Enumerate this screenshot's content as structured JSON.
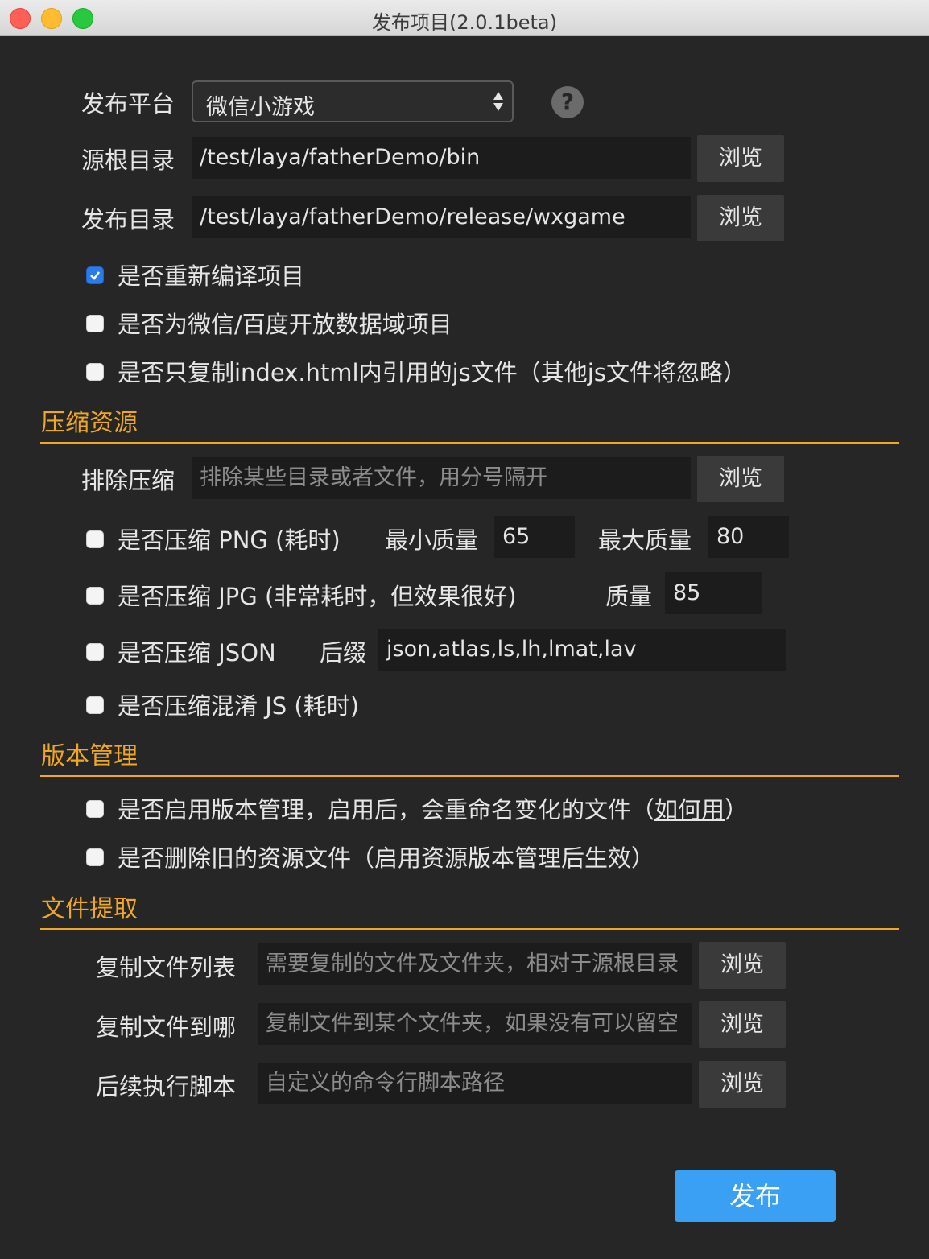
{
  "window": {
    "title": "发布项目(2.0.1beta)"
  },
  "platform": {
    "label": "发布平台",
    "value": "微信小游戏"
  },
  "source_dir": {
    "label": "源根目录",
    "value": "/test/laya/fatherDemo/bin",
    "browse": "浏览"
  },
  "release_dir": {
    "label": "发布目录",
    "value": "/test/laya/fatherDemo/release/wxgame",
    "browse": "浏览"
  },
  "options": {
    "recompile": {
      "label": "是否重新编译项目",
      "checked": true
    },
    "open_data": {
      "label": "是否为微信/百度开放数据域项目",
      "checked": false
    },
    "index_js_only": {
      "label": "是否只复制index.html内引用的js文件（其他js文件将忽略）",
      "checked": false
    }
  },
  "compress": {
    "section_title": "压缩资源",
    "exclude": {
      "label": "排除压缩",
      "placeholder": "排除某些目录或者文件，用分号隔开",
      "browse": "浏览"
    },
    "png": {
      "label": "是否压缩 PNG (耗时)",
      "min_label": "最小质量",
      "min_value": "65",
      "max_label": "最大质量",
      "max_value": "80"
    },
    "jpg": {
      "label": "是否压缩 JPG (非常耗时，但效果很好)",
      "quality_label": "质量",
      "quality_value": "85"
    },
    "json": {
      "label": "是否压缩 JSON",
      "suffix_label": "后缀",
      "suffix_value": "json,atlas,ls,lh,lmat,lav"
    },
    "js": {
      "label": "是否压缩混淆 JS (耗时)"
    }
  },
  "version": {
    "section_title": "版本管理",
    "enable": {
      "label": "是否启用版本管理，启用后，会重命名变化的文件（",
      "link": "如何用",
      "close": "）"
    },
    "delete_old": {
      "label": "是否删除旧的资源文件（启用资源版本管理后生效）"
    }
  },
  "extract": {
    "section_title": "文件提取",
    "copy_list": {
      "label": "复制文件列表",
      "placeholder": "需要复制的文件及文件夹，相对于源根目录",
      "browse": "浏览"
    },
    "copy_to": {
      "label": "复制文件到哪",
      "placeholder": "复制文件到某个文件夹，如果没有可以留空",
      "browse": "浏览"
    },
    "script": {
      "label": "后续执行脚本",
      "placeholder": "自定义的命令行脚本路径",
      "browse": "浏览"
    }
  },
  "publish_button": "发布",
  "colors": {
    "accent": "#f0a823",
    "primary_button": "#3aa0f4",
    "background": "#262626"
  }
}
